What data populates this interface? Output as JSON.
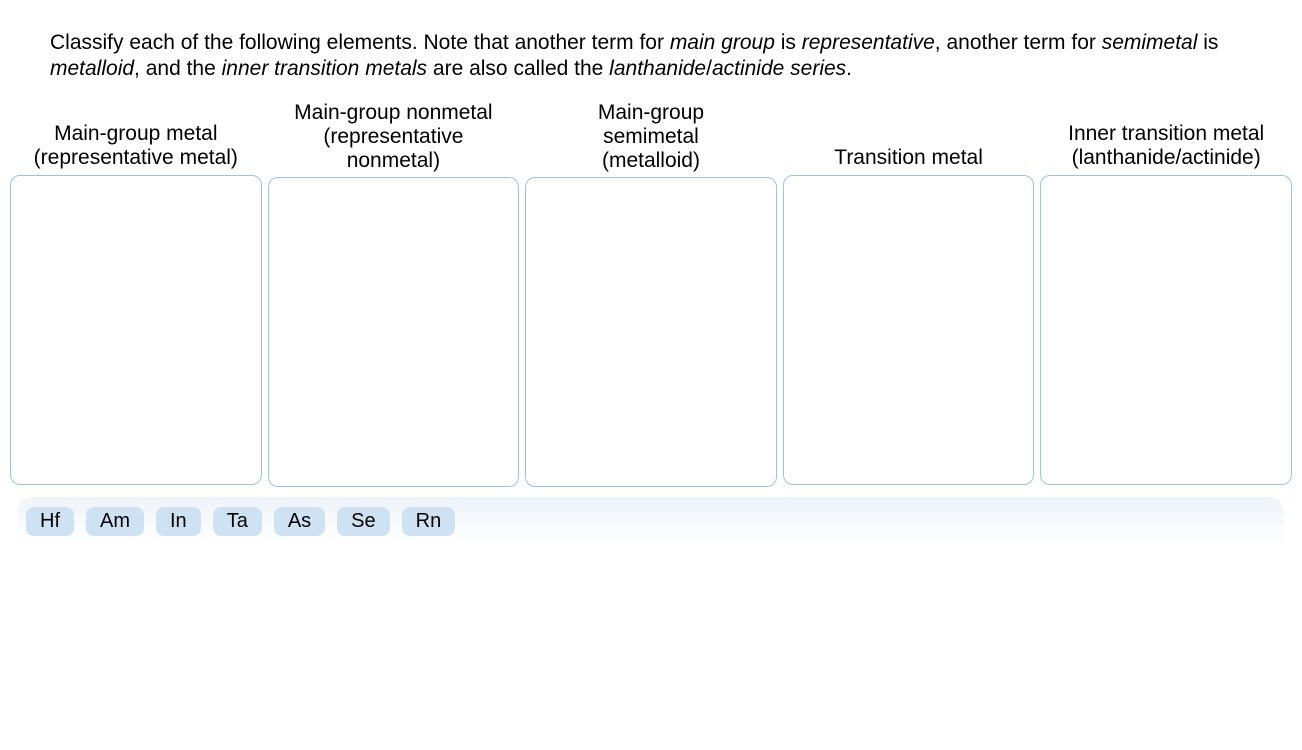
{
  "prompt": {
    "p1a": "Classify each of the following elements. Note that another term for ",
    "p1b": "main group",
    "p1c": " is ",
    "p1d": "representative",
    "p1e": ", another term for ",
    "p1f": "semimetal",
    "p1g": " is ",
    "p1h": "metalloid",
    "p1i": ", and the ",
    "p1j": "inner transition metals",
    "p1k": " are also called the ",
    "p1l": "lanthanide",
    "p1m": "/",
    "p1n": "actinide series",
    "p1o": "."
  },
  "columns": [
    {
      "line1": "Main-group metal",
      "line2": "(representative metal)"
    },
    {
      "line1": "Main-group nonmetal",
      "line2": "(representative",
      "line3": "nonmetal)"
    },
    {
      "line1": "Main-group",
      "line2": "semimetal",
      "line3": "(metalloid)"
    },
    {
      "line1": "Transition metal",
      "line2": ""
    },
    {
      "line1": "Inner transition metal",
      "line2": "(lanthanide/actinide)"
    }
  ],
  "chips": [
    "Hf",
    "Am",
    "In",
    "Ta",
    "As",
    "Se",
    "Rn"
  ]
}
